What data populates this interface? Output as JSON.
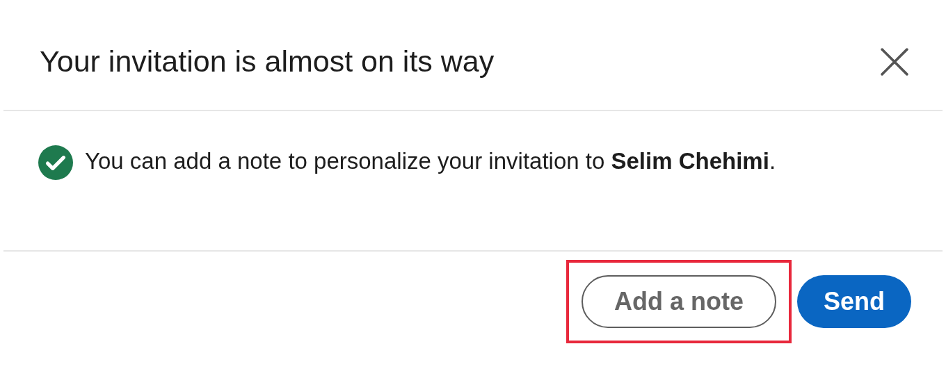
{
  "dialog": {
    "title": "Your invitation is almost on its way",
    "message": "You can add a note to personalize your invitation to **Selim Chehimi**.",
    "buttons": [
      {
        "label": "Add a note",
        "kind": "secondary",
        "highlighted": true
      },
      {
        "label": "Send",
        "kind": "primary",
        "highlighted": false
      }
    ]
  }
}
